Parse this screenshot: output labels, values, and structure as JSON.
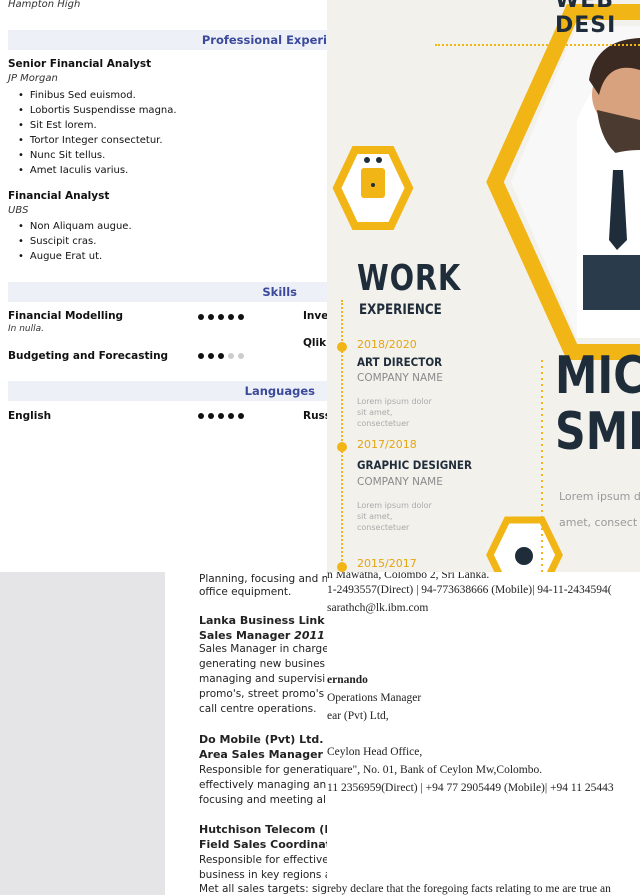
{
  "resume": {
    "school": "Hampton High",
    "experience_heading": "Professional Experi",
    "jobs": [
      {
        "title": "Senior Financial Analyst",
        "company": "JP Morgan",
        "bullets": [
          "Finibus Sed euismod.",
          "Lobortis Suspendisse magna.",
          "Sit Est lorem.",
          "Tortor Integer consectetur.",
          "Nunc Sit tellus.",
          "Amet Iaculis varius."
        ]
      },
      {
        "title": "Financial Analyst",
        "company": "UBS",
        "bullets": [
          "Non Aliquam augue.",
          "Suscipit cras.",
          "Augue Erat ut."
        ]
      }
    ],
    "skills_heading": "Skills",
    "skills": [
      {
        "name": "Financial Modelling",
        "sub": "In nulla.",
        "level": 5,
        "right": "Inve"
      },
      {
        "name": "",
        "sub": "",
        "level": 0,
        "right": "Qlik"
      },
      {
        "name": "Budgeting and Forecasting",
        "sub": "",
        "level": 3,
        "right": ""
      }
    ],
    "languages_heading": "Languages",
    "languages": [
      {
        "name": "English",
        "level": 5,
        "right": "Russ"
      }
    ]
  },
  "infographic": {
    "banner": "WEB DESI",
    "work": "WORK",
    "experience": "EXPERIENCE",
    "entries": [
      {
        "year": "2018/2020",
        "role": "ART DIRECTOR",
        "company": "COMPANY NAME",
        "lorem": "Lorem ipsum dolor sit amet, consectetuer"
      },
      {
        "year": "2017/2018",
        "role": "GRAPHIC DESIGNER",
        "company": "COMPANY NAME",
        "lorem": "Lorem ipsum dolor sit amet, consectetuer"
      },
      {
        "year": "2015/2017",
        "role": "",
        "company": "",
        "lorem": ""
      }
    ],
    "first_name": "MICHA",
    "last_name": "SMIT",
    "right_lorem_1": "Lorem ipsum d",
    "right_lorem_2": "amet, consect",
    "colors": {
      "accent": "#f2b516",
      "dark": "#1f2c3a"
    }
  },
  "cv": {
    "lines": [
      {
        "text": "Planning, focusing and m",
        "bold": false
      },
      {
        "text": "office equipment.",
        "bold": false
      },
      {
        "text": "Lanka Business Link (",
        "bold": true
      },
      {
        "text": "Sales Manager 2011 (",
        "bold": true
      },
      {
        "text": "Sales Manager in charge",
        "bold": false
      },
      {
        "text": "generating new busines",
        "bold": false
      },
      {
        "text": "managing and supervisi",
        "bold": false
      },
      {
        "text": "promo's, street promo's",
        "bold": false
      },
      {
        "text": "call centre operations.",
        "bold": false
      },
      {
        "text": "Do Mobile (Pvt) Ltd.",
        "bold": true
      },
      {
        "text": "Area Sales Manager 2",
        "bold": true
      },
      {
        "text": "Responsible for generati",
        "bold": false
      },
      {
        "text": "effectively managing an",
        "bold": false
      },
      {
        "text": "focusing and meeting al",
        "bold": false
      },
      {
        "text": "Hutchison Telecom (P",
        "bold": true
      },
      {
        "text": "Field Sales Coordinat",
        "bold": true
      },
      {
        "text": "Responsible for effective",
        "bold": false
      },
      {
        "text": "business in key regions a",
        "bold": false
      },
      {
        "text": "Met all sales targets: sign",
        "bold": false
      }
    ]
  },
  "contacts": {
    "lines": [
      {
        "text": "n Mawatha, Colombo 2, Sri Lanka.",
        "bold": false
      },
      {
        "text": "1-2493557(Direct) | 94-773638666 (Mobile)| 94-11-2434594(",
        "bold": false
      },
      {
        "text": "sarathch@lk.ibm.com",
        "bold": false
      },
      {
        "text": "ernando",
        "bold": true
      },
      {
        "text": "Operations Manager",
        "bold": false
      },
      {
        "text": "ear (Pvt) Ltd,",
        "bold": false
      },
      {
        "text": "",
        "bold": false
      },
      {
        "text": "Ceylon Head Office,",
        "bold": false
      },
      {
        "text": "quare\", No. 01, Bank of Ceylon Mw,Colombo.",
        "bold": false
      },
      {
        "text": "11 2356959(Direct) | +94 77 2905449 (Mobile)| +94 11 25443",
        "bold": false
      },
      {
        "text": "reby declare that the foregoing facts relating to me are true an",
        "bold": false
      }
    ]
  }
}
